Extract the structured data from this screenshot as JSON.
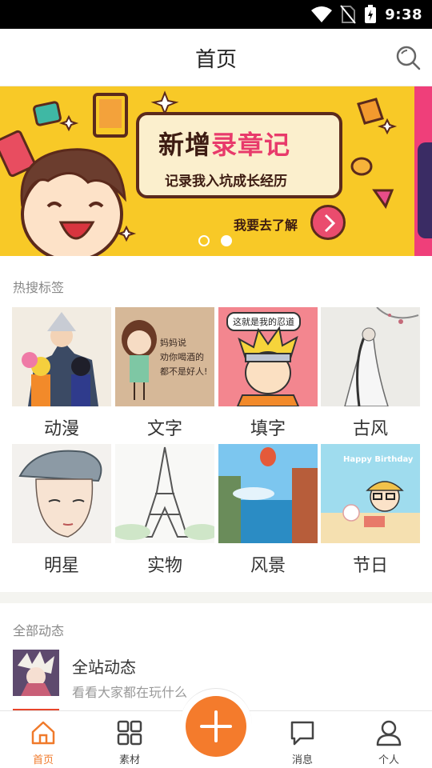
{
  "status_bar": {
    "time": "9:38"
  },
  "header": {
    "title": "首页"
  },
  "banner": {
    "headline_prefix": "新增",
    "headline_accent": "录章记",
    "subline": "记录我入坑成长经历",
    "cta": "我要去了解"
  },
  "hot_tags": {
    "label": "热搜标签",
    "items": [
      {
        "label": "动漫"
      },
      {
        "label": "文字",
        "art_text": "妈妈说\n劝你喝酒的\n都不是好人!"
      },
      {
        "label": "填字",
        "art_text": "这就是我的忍道"
      },
      {
        "label": "古风"
      },
      {
        "label": "明星"
      },
      {
        "label": "实物"
      },
      {
        "label": "风景"
      },
      {
        "label": "节日",
        "art_text": "Happy Birthday"
      }
    ]
  },
  "feed": {
    "label": "全部动态",
    "items": [
      {
        "title": "全站动态",
        "subtitle": "看看大家都在玩什么"
      }
    ]
  },
  "tab_bar": {
    "tabs": [
      {
        "label": "首页",
        "icon": "home-icon",
        "active": true
      },
      {
        "label": "素材",
        "icon": "grid-icon"
      },
      {
        "label": "消息",
        "icon": "message-icon"
      },
      {
        "label": "个人",
        "icon": "person-icon"
      }
    ],
    "fab_icon": "plus-icon"
  },
  "colors": {
    "accent": "#f47b2c",
    "banner_bg": "#f8c927"
  }
}
